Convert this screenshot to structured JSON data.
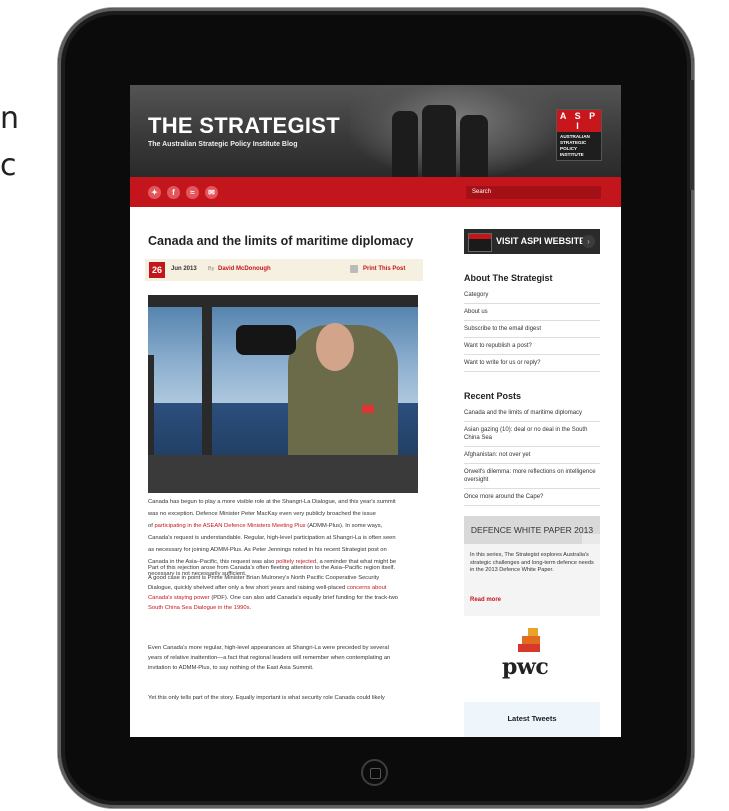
{
  "background_text": [
    "n",
    "c"
  ],
  "site": {
    "title": "THE STRATEGIST",
    "subtitle": "The Australian Strategic Policy Institute Blog",
    "logo_letters": "A S P I",
    "logo_words": "AUSTRALIAN\nSTRATEGIC\nPOLICY\nINSTITUTE"
  },
  "nav": {
    "social_icons": [
      "twitter-icon",
      "facebook-icon",
      "rss-icon",
      "email-icon"
    ],
    "social_glyphs": [
      "✦",
      "f",
      "≈",
      "✉"
    ],
    "search_placeholder": "Search"
  },
  "post": {
    "title": "Canada and the limits of maritime diplomacy",
    "day": "26",
    "month_year": "Jun 2013",
    "by_label": "By",
    "author": "David McDonough",
    "print_label": "Print This Post",
    "paragraphs": [
      {
        "lines": [
          [
            "Canada has begun to play a more visible role at the Shangri-La Dialogue, and this year's summit"
          ],
          [
            "was no exception. Defence Minister Peter MacKay even very publicly broached the issue"
          ],
          [
            "of ",
            {
              "link": "participating in the ASEAN Defence Ministers Meeting Plus"
            },
            " (ADMM-Plus). In some ways,"
          ],
          [
            "Canada's request is understandable. Regular, high-level participation at Shangri-La is often seen"
          ],
          [
            "as necessary for joining ADMM-Plus. As Peter Jennings noted in his recent Strategist post on"
          ],
          [
            "Canada in the Asia–Pacific, this request was also ",
            {
              "link": "politely rejected"
            },
            ", a reminder that what might be"
          ],
          [
            "necessary is not necessarily sufficient."
          ]
        ]
      },
      {
        "lines": [
          [
            "Part of this rejection arose from Canada's often fleeting attention to the Asia–Pacific region itself."
          ],
          [
            "A good case in point is Prime Minister Brian Mulroney's North Pacific Cooperative Security"
          ],
          [
            "Dialogue, quickly shelved after only a few short years and raising well-placed ",
            {
              "link": "concerns about"
            }
          ],
          [
            {
              "link": "Canada's staying power"
            },
            " (PDF). One can also add Canada's equally brief funding for the track-two"
          ],
          [
            {
              "link": "South China Sea Dialogue in the 1990s"
            },
            "."
          ]
        ]
      },
      {
        "lines": [
          [
            "Even Canada's more regular, high-level appearances at Shangri-La were preceded by several"
          ],
          [
            "years of relative inattention—a fact that regional leaders will remember when contemplating an"
          ],
          [
            "invitation to ADMM-Plus, to say nothing of the East Asia Summit."
          ]
        ]
      },
      {
        "lines": [
          [
            "Yet this only tells part of the story. Equally important is what security role Canada could likely"
          ]
        ]
      }
    ]
  },
  "sidebar": {
    "visit_label": "VISIT ASPI WEBSITE",
    "about_heading": "About The Strategist",
    "about_links": [
      "Category",
      "About us",
      "Subscribe to the email digest",
      "Want to republish a post?",
      "Want to write for us or reply?"
    ],
    "recent_heading": "Recent Posts",
    "recent_posts": [
      "Canada and the limits of maritime diplomacy",
      "Asian gazing (10): deal or no deal in the South China Sea",
      "Afghanistan: not over yet",
      "Orwell's dilemma: more reflections on intelligence oversight",
      "Once more around the Cape?"
    ],
    "dwp_heading": "DEFENCE WHITE PAPER 2013",
    "dwp_text": "In this series, The Strategist explores Australia's strategic challenges and long-term defence needs in the 2013 Defence White Paper.",
    "dwp_more": "Read more",
    "sponsor_logo": "pwc",
    "tweets_heading": "Latest Tweets"
  }
}
